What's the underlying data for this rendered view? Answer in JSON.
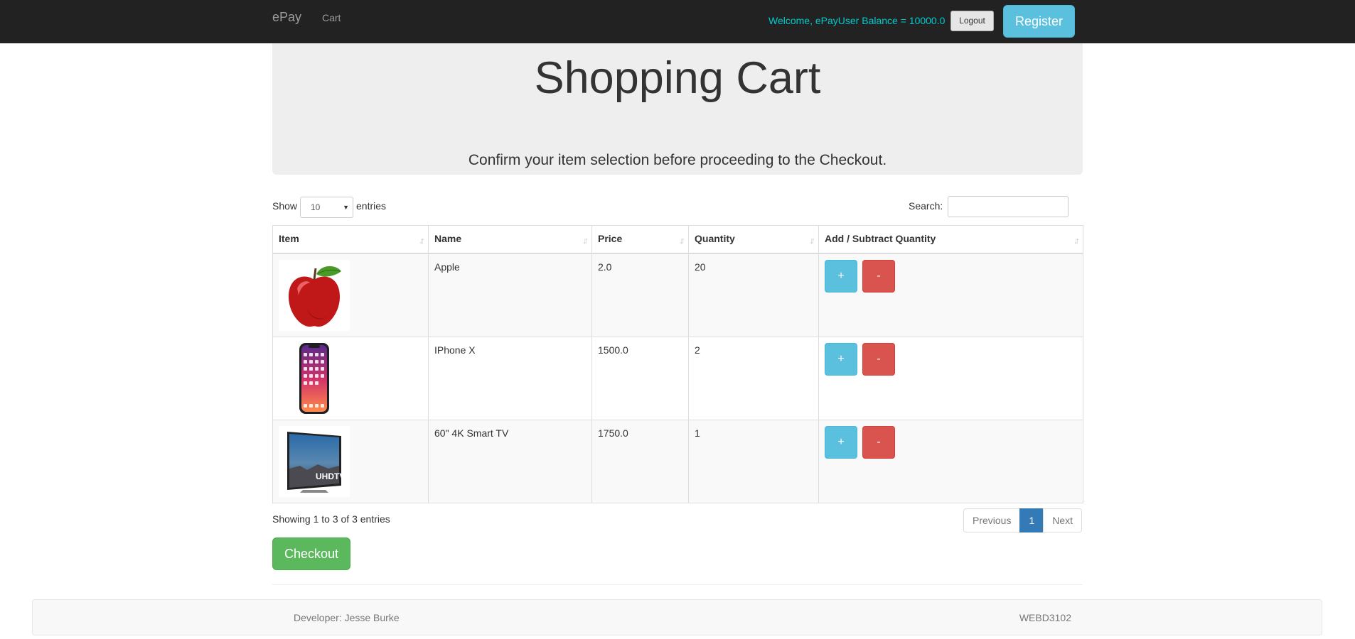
{
  "navbar": {
    "brand": "ePay",
    "links": [
      {
        "label": "Cart"
      }
    ],
    "welcome": "Welcome, ePayUser Balance = 10000.0",
    "logout_label": "Logout",
    "register_label": "Register"
  },
  "jumbotron": {
    "title": "Shopping Cart",
    "subtitle": "Confirm your item selection before proceeding to the Checkout."
  },
  "table_controls": {
    "show_label": "Show",
    "entries_value": "10",
    "entries_label": "entries",
    "search_label": "Search:",
    "search_value": ""
  },
  "table": {
    "columns": [
      "Item",
      "Name",
      "Price",
      "Quantity",
      "Add / Subtract Quantity"
    ],
    "rows": [
      {
        "image": "apple-image",
        "name": "Apple",
        "price": "2.0",
        "quantity": "20",
        "add_label": "+",
        "sub_label": "-"
      },
      {
        "image": "iphone-image",
        "name": "IPhone X",
        "price": "1500.0",
        "quantity": "2",
        "add_label": "+",
        "sub_label": "-"
      },
      {
        "image": "tv-image",
        "name": "60\" 4K Smart TV",
        "price": "1750.0",
        "quantity": "1",
        "add_label": "+",
        "sub_label": "-",
        "image_text": "UHDTV"
      }
    ]
  },
  "info": "Showing 1 to 3 of 3 entries",
  "pagination": {
    "previous": "Previous",
    "current": "1",
    "next": "Next"
  },
  "checkout_label": "Checkout",
  "footer": {
    "developer": "Developer: Jesse Burke",
    "course": "WEBD3102"
  },
  "colors": {
    "navbar_bg": "#222222",
    "welcome_text": "#00cccc",
    "info_button": "#5bc0de",
    "danger_button": "#d9534f",
    "success_button": "#5cb85c",
    "pagination_active": "#337ab7"
  }
}
